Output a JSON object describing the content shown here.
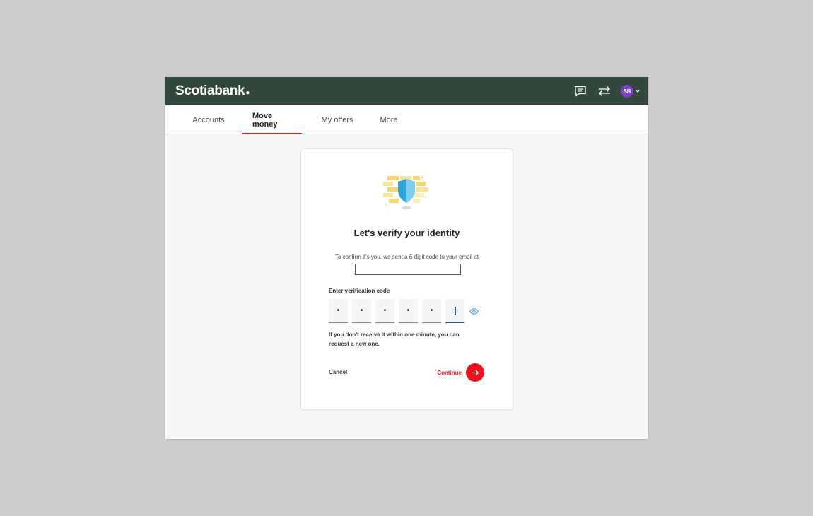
{
  "header": {
    "logo_text": "Scotiabank",
    "avatar_initials": "SB",
    "icons": [
      "chat-icon",
      "transfer-icon",
      "chevron-down-icon"
    ]
  },
  "nav": {
    "tabs": [
      {
        "label": "Accounts",
        "active": false
      },
      {
        "label": "Move money",
        "active": true
      },
      {
        "label": "My offers",
        "active": false
      },
      {
        "label": "More",
        "active": false
      }
    ]
  },
  "verify": {
    "title": "Let's verify your identity",
    "description": "To confirm it's you, we sent a 6-digit code to your email at",
    "email_value": "",
    "code_label": "Enter verification code",
    "code_digits": [
      "•",
      "•",
      "•",
      "•",
      "•",
      ""
    ],
    "hint": "If you don't receive it within one minute, you can request a new one.",
    "cancel_label": "Cancel",
    "continue_label": "Continue"
  },
  "colors": {
    "header_bg": "#33483d",
    "accent_red": "#ec111a",
    "avatar_bg": "#7b3fbf",
    "focus_blue": "#1a5fb4"
  }
}
